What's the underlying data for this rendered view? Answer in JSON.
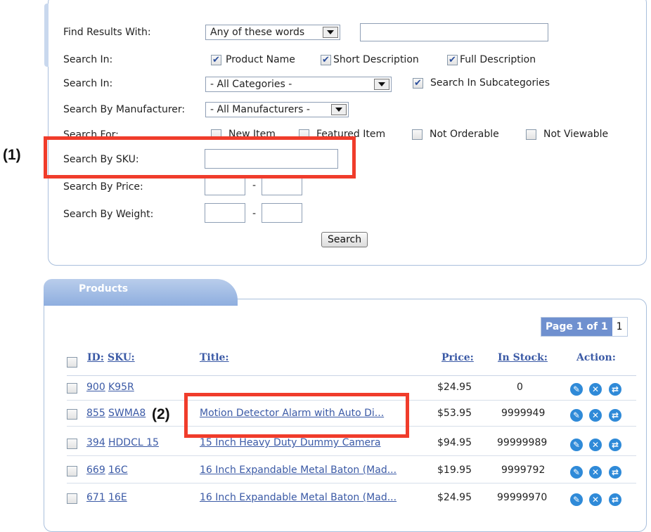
{
  "search": {
    "find_results_label": "Find Results With:",
    "find_results_value": "Any of these words",
    "keyword_value": "",
    "search_in_label": "Search In:",
    "search_in_options": [
      {
        "label": "Product Name",
        "checked": true
      },
      {
        "label": "Short Description",
        "checked": true
      },
      {
        "label": "Full Description",
        "checked": true
      }
    ],
    "category_label": "Search In:",
    "category_value": "- All Categories -",
    "subcategories_label": "Search In Subcategories",
    "subcategories_checked": true,
    "manufacturer_label": "Search By Manufacturer:",
    "manufacturer_value": "- All Manufacturers -",
    "search_for_label": "Search For:",
    "search_for_options": [
      {
        "label": "New Item",
        "checked": false
      },
      {
        "label": "Featured Item",
        "checked": false
      },
      {
        "label": "Not Orderable",
        "checked": false
      },
      {
        "label": "Not Viewable",
        "checked": false
      }
    ],
    "sku_label": "Search By SKU:",
    "sku_value": "",
    "price_label": "Search By Price:",
    "weight_label": "Search By Weight:",
    "range_sep": "-",
    "search_button": "Search"
  },
  "annotations": {
    "one": "(1)",
    "two": "(2)"
  },
  "products": {
    "tab_label": "Products",
    "pager_label": "Page 1 of 1",
    "pager_page": "1",
    "headers": {
      "id": "ID:",
      "sku": "SKU:",
      "title": "Title:",
      "price": "Price:",
      "stock": "In Stock:",
      "action": "Action:"
    },
    "rows": [
      {
        "id": "900",
        "sku": "K95R",
        "title": "",
        "price": "$24.95",
        "stock": "0"
      },
      {
        "id": "855",
        "sku": "SWMA8",
        "title": "Motion Detector Alarm with Auto Di...",
        "price": "$53.95",
        "stock": "9999949"
      },
      {
        "id": "394",
        "sku": "HDDCL 15",
        "title": "15 Inch Heavy Duty Dummy Camera",
        "price": "$94.95",
        "stock": "99999989"
      },
      {
        "id": "669",
        "sku": "16C",
        "title": "16 Inch Expandable Metal Baton (Mad...",
        "price": "$19.95",
        "stock": "9999792"
      },
      {
        "id": "671",
        "sku": "16E",
        "title": "16 Inch Expandable Metal Baton (Mad...",
        "price": "$24.95",
        "stock": "99999970"
      }
    ],
    "action_icons": [
      "edit-icon",
      "delete-icon",
      "copy-icon"
    ]
  },
  "colors": {
    "accent": "#3b5aa6",
    "annotation": "#f03c2b",
    "tab": "#8eaedf",
    "action": "#2f8ad8"
  }
}
